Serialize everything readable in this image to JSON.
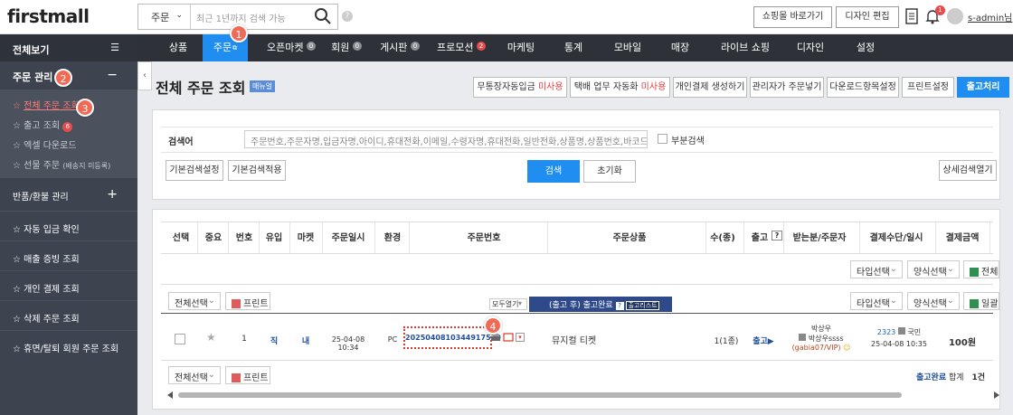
{
  "brand": "firstmall",
  "search": {
    "type": "주문",
    "placeholder": "최근 1년까지 검색 가능"
  },
  "topbar": {
    "shop_link": "쇼핑몰 바로가기",
    "design_edit": "디자인 편집",
    "notice_count": "1",
    "user": "s-admin님"
  },
  "sidebar": {
    "header": "전체보기",
    "group_order": "주문 관리",
    "order_items": [
      {
        "label": "전체 주문 조회"
      },
      {
        "label": "출고 조회",
        "badge": "6"
      },
      {
        "label": "엑셀 다운로드"
      },
      {
        "label": "선물 주문",
        "note": "(배송지 미등록)"
      }
    ],
    "group_return": "반품/환불 관리",
    "items": [
      "자동 입금 확인",
      "매출 증빙 조회",
      "개인 결제 조회",
      "삭제 주문 조회",
      "휴면/탈퇴 회원 주문 조회"
    ]
  },
  "nav": {
    "tabs": [
      {
        "label": "상품"
      },
      {
        "label": "주문",
        "active": true
      },
      {
        "label": "오픈마켓",
        "count": "0"
      },
      {
        "label": "회원",
        "count": "0"
      },
      {
        "label": "게시판",
        "count": "0"
      },
      {
        "label": "프로모션",
        "count": "2",
        "red": true
      },
      {
        "label": "마케팅"
      },
      {
        "label": "통계"
      },
      {
        "label": "모바일"
      },
      {
        "label": "매장"
      },
      {
        "label": "라이브 쇼핑"
      },
      {
        "label": "디자인"
      },
      {
        "label": "설정"
      }
    ]
  },
  "page": {
    "title": "전체 주문 조회",
    "manual": "매뉴얼",
    "buttons": {
      "b1": "무통장자동입금",
      "b1s": "미사용",
      "b2": "택배 업무 자동화",
      "b2s": "미사용",
      "b3": "개인결제 생성하기",
      "b4": "관리자가 주문넣기",
      "b5": "다운로드항목설정",
      "b6": "프린트설정",
      "b7": "출고처리"
    }
  },
  "searchpanel": {
    "label": "검색어",
    "keywords": "주문번호,주문자명,입금자명,아이디,휴대전화,이메일,수령자명,휴대전화,일반전화,상품명,상품번호,바코드",
    "partial": "부분검색",
    "basic_setting": "기본검색설정",
    "basic_apply": "기본검색적용",
    "search": "검색",
    "reset": "초기화",
    "detail": "상세검색열기"
  },
  "table": {
    "headers": [
      "선택",
      "중요",
      "번호",
      "유입",
      "마켓",
      "주문일시",
      "환경",
      "주문번호",
      "주문상품",
      "수(종)",
      "출고",
      "받는분/주문자",
      "결제수단/일시",
      "결제금액"
    ],
    "select_all": "전체선택",
    "print": "프린트",
    "type_select": "타입선택",
    "form_select": "양식선택",
    "excel_all": "전체다",
    "excel_bulk": "일괄다",
    "open_all": "모두열기",
    "status_bar": "(출고 후) 출고완료",
    "status_link": "출고리스트",
    "row": {
      "no": "1",
      "inflow": "직",
      "market": "내",
      "date": "25-04-08 10:34",
      "env": "PC",
      "order_no": "2025040810344917530",
      "product": "뮤지컬 티켓",
      "qty": "1(1종)",
      "ship": "출고▶",
      "recipient": "박상우",
      "orderer": "박상우ssss",
      "orderer_id": "(gabia07/VIP)",
      "pay_no": "2323",
      "pay_method": "국민",
      "pay_date": "25-04-08 10:35",
      "amount": "100원"
    },
    "footer": {
      "status": "출고완료",
      "sum_label": "합계",
      "count": "1건"
    }
  },
  "steps": [
    "1",
    "2",
    "3",
    "4"
  ]
}
